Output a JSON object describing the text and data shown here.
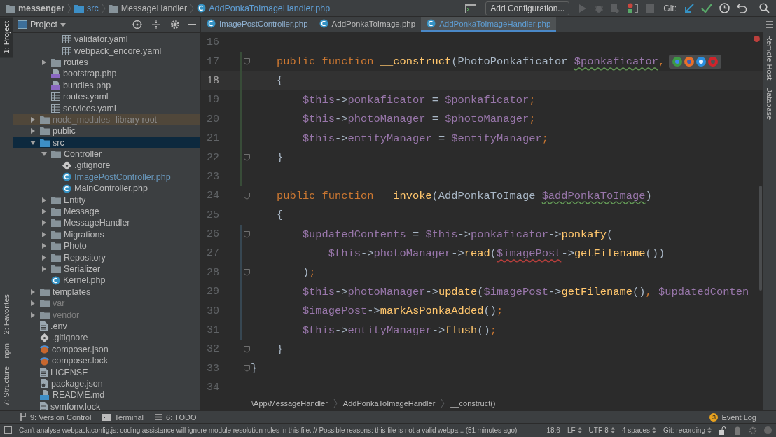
{
  "nav": {
    "crumbs": [
      {
        "label": "messenger",
        "kind": "root"
      },
      {
        "label": "src",
        "kind": "source"
      },
      {
        "label": "MessageHandler",
        "kind": "folder"
      },
      {
        "label": "AddPonkaToImageHandler.php",
        "kind": "class"
      }
    ],
    "config_button": "Add Configuration...",
    "git_label": "Git:"
  },
  "left_strip": [
    {
      "label": "1: Project",
      "selected": true
    },
    {
      "label": "2: Favorites",
      "selected": false
    },
    {
      "label": "npm",
      "selected": false
    },
    {
      "label": "7: Structure",
      "selected": false
    }
  ],
  "right_strip": [
    {
      "label": "Remote Host"
    },
    {
      "label": "Database"
    }
  ],
  "project": {
    "title": "Project",
    "tree": [
      {
        "children": [
          {
            "children": [
              {
                "label": "validator.yaml",
                "kind": "yaml",
                "selected": false,
                "modified": false,
                "excluded": false,
                "library": false
              },
              {
                "label": "webpack_encore.yaml",
                "kind": "yaml",
                "selected": false,
                "modified": false,
                "excluded": false,
                "library": false
              }
            ]
          },
          {
            "label": "routes",
            "kind": "folder",
            "expanded": false,
            "selected": false,
            "modified": false,
            "excluded": false,
            "library": false
          },
          {
            "label": "bootstrap.php",
            "kind": "php",
            "selected": false,
            "modified": false,
            "excluded": false,
            "library": false
          },
          {
            "label": "bundles.php",
            "kind": "php",
            "selected": false,
            "modified": false,
            "excluded": false,
            "library": false
          },
          {
            "label": "routes.yaml",
            "kind": "yaml",
            "selected": false,
            "modified": false,
            "excluded": false,
            "library": false
          },
          {
            "label": "services.yaml",
            "kind": "yaml",
            "selected": false,
            "modified": false,
            "excluded": false,
            "library": false
          }
        ]
      },
      {
        "label": "node_modules",
        "kind": "folder",
        "expanded": false,
        "selected": false,
        "modified": false,
        "excluded": true,
        "library": true,
        "note": "library root"
      },
      {
        "label": "public",
        "kind": "folder",
        "expanded": false,
        "selected": false,
        "modified": false,
        "excluded": false,
        "library": false
      },
      {
        "label": "src",
        "kind": "source",
        "expanded": true,
        "selected": true,
        "modified": false,
        "excluded": false,
        "library": false,
        "children": [
          {
            "label": "Controller",
            "kind": "folder",
            "expanded": true,
            "selected": false,
            "modified": false,
            "excluded": false,
            "library": false,
            "children": [
              {
                "label": ".gitignore",
                "kind": "git",
                "selected": false,
                "modified": false,
                "excluded": false,
                "library": false
              },
              {
                "label": "ImagePostController.php",
                "kind": "class",
                "selected": false,
                "modified": true,
                "excluded": false,
                "library": false
              },
              {
                "label": "MainController.php",
                "kind": "class",
                "selected": false,
                "modified": false,
                "excluded": false,
                "library": false
              }
            ]
          },
          {
            "label": "Entity",
            "kind": "folder",
            "expanded": false,
            "selected": false,
            "modified": false,
            "excluded": false,
            "library": false
          },
          {
            "label": "Message",
            "kind": "folder",
            "expanded": false,
            "selected": false,
            "modified": false,
            "excluded": false,
            "library": false
          },
          {
            "label": "MessageHandler",
            "kind": "folder",
            "expanded": false,
            "selected": false,
            "modified": false,
            "excluded": false,
            "library": false
          },
          {
            "label": "Migrations",
            "kind": "folder",
            "expanded": false,
            "selected": false,
            "modified": false,
            "excluded": false,
            "library": false
          },
          {
            "label": "Photo",
            "kind": "folder",
            "expanded": false,
            "selected": false,
            "modified": false,
            "excluded": false,
            "library": false
          },
          {
            "label": "Repository",
            "kind": "folder",
            "expanded": false,
            "selected": false,
            "modified": false,
            "excluded": false,
            "library": false
          },
          {
            "label": "Serializer",
            "kind": "folder",
            "expanded": false,
            "selected": false,
            "modified": false,
            "excluded": false,
            "library": false
          },
          {
            "label": "Kernel.php",
            "kind": "class",
            "selected": false,
            "modified": false,
            "excluded": false,
            "library": false
          }
        ]
      },
      {
        "label": "templates",
        "kind": "folder",
        "expanded": false,
        "selected": false,
        "modified": false,
        "excluded": false,
        "library": false
      },
      {
        "label": "var",
        "kind": "folder",
        "expanded": false,
        "selected": false,
        "modified": false,
        "excluded": true,
        "library": false
      },
      {
        "label": "vendor",
        "kind": "folder",
        "expanded": false,
        "selected": false,
        "modified": false,
        "excluded": true,
        "library": false
      },
      {
        "label": ".env",
        "kind": "text",
        "selected": false,
        "modified": false,
        "excluded": false,
        "library": false
      },
      {
        "label": ".gitignore",
        "kind": "git",
        "selected": false,
        "modified": false,
        "excluded": false,
        "library": false
      },
      {
        "label": "composer.json",
        "kind": "composer",
        "selected": false,
        "modified": false,
        "excluded": false,
        "library": false
      },
      {
        "label": "composer.lock",
        "kind": "composer",
        "selected": false,
        "modified": false,
        "excluded": false,
        "library": false
      },
      {
        "label": "LICENSE",
        "kind": "text",
        "selected": false,
        "modified": false,
        "excluded": false,
        "library": false
      },
      {
        "label": "package.json",
        "kind": "npm",
        "selected": false,
        "modified": false,
        "excluded": false,
        "library": false
      },
      {
        "label": "README.md",
        "kind": "md",
        "selected": false,
        "modified": false,
        "excluded": false,
        "library": false
      },
      {
        "label": "symfony.lock",
        "kind": "text",
        "selected": false,
        "modified": false,
        "excluded": false,
        "library": false
      }
    ]
  },
  "tabs": [
    {
      "label": "ImagePostController.php",
      "selected": false,
      "modified": true
    },
    {
      "label": "AddPonkaToImage.php",
      "selected": false,
      "modified": false
    },
    {
      "label": "AddPonkaToImageHandler.php",
      "selected": true,
      "modified": true
    }
  ],
  "code": [
    {
      "number": "16",
      "current": false,
      "fold": false,
      "added": false,
      "modified": false
    },
    {
      "number": "17",
      "current": false,
      "fold": true,
      "added": true,
      "modified": false,
      "popup": true,
      "tokens": [
        {
          "t": "    public function ",
          "kind": "kw"
        },
        {
          "t": "__construct",
          "kind": "fn"
        },
        {
          "t": "(PhotoPonkaficator ",
          "kind": "plain"
        },
        {
          "t": "$ponkaficator",
          "kind": "var",
          "warning": true
        },
        {
          "t": ",",
          "kind": "punc"
        }
      ]
    },
    {
      "number": "18",
      "current": true,
      "fold": false,
      "added": true,
      "modified": false,
      "tokens": [
        {
          "t": "    {",
          "kind": "plain"
        }
      ]
    },
    {
      "number": "19",
      "current": false,
      "fold": false,
      "added": true,
      "modified": false,
      "tokens": [
        {
          "t": "        $this",
          "kind": "var"
        },
        {
          "t": "->",
          "kind": "plain"
        },
        {
          "t": "ponkaficator",
          "kind": "var"
        },
        {
          "t": " = ",
          "kind": "plain"
        },
        {
          "t": "$ponkaficator",
          "kind": "var"
        },
        {
          "t": ";",
          "kind": "punc"
        }
      ]
    },
    {
      "number": "20",
      "current": false,
      "fold": false,
      "added": true,
      "modified": false,
      "tokens": [
        {
          "t": "        $this",
          "kind": "var"
        },
        {
          "t": "->",
          "kind": "plain"
        },
        {
          "t": "photoManager",
          "kind": "var"
        },
        {
          "t": " = ",
          "kind": "plain"
        },
        {
          "t": "$photoManager",
          "kind": "var"
        },
        {
          "t": ";",
          "kind": "punc"
        }
      ]
    },
    {
      "number": "21",
      "current": false,
      "fold": false,
      "added": true,
      "modified": false,
      "tokens": [
        {
          "t": "        $this",
          "kind": "var"
        },
        {
          "t": "->",
          "kind": "plain"
        },
        {
          "t": "entityManager",
          "kind": "var"
        },
        {
          "t": " = ",
          "kind": "plain"
        },
        {
          "t": "$entityManager",
          "kind": "var"
        },
        {
          "t": ";",
          "kind": "punc"
        }
      ]
    },
    {
      "number": "22",
      "current": false,
      "fold": true,
      "added": true,
      "modified": false,
      "tokens": [
        {
          "t": "    }",
          "kind": "plain"
        }
      ]
    },
    {
      "number": "23",
      "current": false,
      "fold": false,
      "added": true,
      "modified": false
    },
    {
      "number": "24",
      "current": false,
      "fold": true,
      "added": false,
      "modified": false,
      "tokens": [
        {
          "t": "    public function ",
          "kind": "kw"
        },
        {
          "t": "__invoke",
          "kind": "fn"
        },
        {
          "t": "(AddPonkaToImage ",
          "kind": "plain"
        },
        {
          "t": "$addPonkaToImage",
          "kind": "var",
          "warning": true
        },
        {
          "t": ")",
          "kind": "plain"
        }
      ]
    },
    {
      "number": "25",
      "current": false,
      "fold": false,
      "added": false,
      "modified": false,
      "tokens": [
        {
          "t": "    {",
          "kind": "plain"
        }
      ]
    },
    {
      "number": "26",
      "current": false,
      "fold": true,
      "added": false,
      "modified": true,
      "tokens": [
        {
          "t": "        $updatedContents",
          "kind": "var"
        },
        {
          "t": " = ",
          "kind": "plain"
        },
        {
          "t": "$this",
          "kind": "var"
        },
        {
          "t": "->",
          "kind": "plain"
        },
        {
          "t": "ponkaficator",
          "kind": "var"
        },
        {
          "t": "->",
          "kind": "plain"
        },
        {
          "t": "ponkafy",
          "kind": "fn"
        },
        {
          "t": "(",
          "kind": "plain"
        }
      ]
    },
    {
      "number": "27",
      "current": false,
      "fold": false,
      "added": false,
      "modified": true,
      "tokens": [
        {
          "t": "            $this",
          "kind": "var"
        },
        {
          "t": "->",
          "kind": "plain"
        },
        {
          "t": "photoManager",
          "kind": "var"
        },
        {
          "t": "->",
          "kind": "plain"
        },
        {
          "t": "read",
          "kind": "fn"
        },
        {
          "t": "(",
          "kind": "plain"
        },
        {
          "t": "$imagePost",
          "kind": "var",
          "error": true
        },
        {
          "t": "->",
          "kind": "plain"
        },
        {
          "t": "getFilename",
          "kind": "fn"
        },
        {
          "t": "())",
          "kind": "plain"
        }
      ]
    },
    {
      "number": "28",
      "current": false,
      "fold": true,
      "added": false,
      "modified": true,
      "tokens": [
        {
          "t": "        )",
          "kind": "plain"
        },
        {
          "t": ";",
          "kind": "punc"
        }
      ]
    },
    {
      "number": "29",
      "current": false,
      "fold": false,
      "added": false,
      "modified": true,
      "tokens": [
        {
          "t": "        $this",
          "kind": "var"
        },
        {
          "t": "->",
          "kind": "plain"
        },
        {
          "t": "photoManager",
          "kind": "var"
        },
        {
          "t": "->",
          "kind": "plain"
        },
        {
          "t": "update",
          "kind": "fn"
        },
        {
          "t": "(",
          "kind": "plain"
        },
        {
          "t": "$imagePost",
          "kind": "var"
        },
        {
          "t": "->",
          "kind": "plain"
        },
        {
          "t": "getFilename",
          "kind": "fn"
        },
        {
          "t": "()",
          "kind": "plain"
        },
        {
          "t": ", ",
          "kind": "punc"
        },
        {
          "t": "$updatedConten",
          "kind": "var"
        }
      ]
    },
    {
      "number": "30",
      "current": false,
      "fold": false,
      "added": false,
      "modified": true,
      "tokens": [
        {
          "t": "        $imagePost",
          "kind": "var"
        },
        {
          "t": "->",
          "kind": "plain"
        },
        {
          "t": "markAsPonkaAdded",
          "kind": "fn"
        },
        {
          "t": "()",
          "kind": "plain"
        },
        {
          "t": ";",
          "kind": "punc"
        }
      ]
    },
    {
      "number": "31",
      "current": false,
      "fold": false,
      "added": false,
      "modified": true,
      "tokens": [
        {
          "t": "        $this",
          "kind": "var"
        },
        {
          "t": "->",
          "kind": "plain"
        },
        {
          "t": "entityManager",
          "kind": "var"
        },
        {
          "t": "->",
          "kind": "plain"
        },
        {
          "t": "flush",
          "kind": "fn"
        },
        {
          "t": "()",
          "kind": "plain"
        },
        {
          "t": ";",
          "kind": "punc"
        }
      ]
    },
    {
      "number": "32",
      "current": false,
      "fold": true,
      "added": false,
      "modified": false,
      "tokens": [
        {
          "t": "    }",
          "kind": "plain"
        }
      ]
    },
    {
      "number": "33",
      "current": false,
      "fold": true,
      "added": false,
      "modified": false,
      "tokens": [
        {
          "t": "}",
          "kind": "plain"
        }
      ]
    },
    {
      "number": "34",
      "current": false,
      "fold": false,
      "added": false,
      "modified": false
    }
  ],
  "breadcrumb": [
    "\\App\\MessageHandler",
    "AddPonkaToImageHandler",
    "__construct()"
  ],
  "tool_windows": [
    {
      "label": "9: Version Control",
      "kind": "vcs"
    },
    {
      "label": "Terminal",
      "kind": "terminal"
    },
    {
      "label": "6: TODO",
      "kind": "todo"
    }
  ],
  "event_log": {
    "label": "Event Log",
    "count": "3"
  },
  "status": {
    "message": "Can't analyse webpack.config.js: coding assistance will ignore module resolution rules in this file. // Possible reasons: this file is not a valid webpa... (51 minutes ago)",
    "items": [
      {
        "text": "18:6",
        "kind": "position"
      },
      {
        "text": "LF",
        "kind": "chooser"
      },
      {
        "text": "UTF-8",
        "kind": "chooser"
      },
      {
        "text": "4 spaces",
        "kind": "chooser"
      },
      {
        "text": "Git: recording",
        "kind": "chooser"
      }
    ]
  }
}
